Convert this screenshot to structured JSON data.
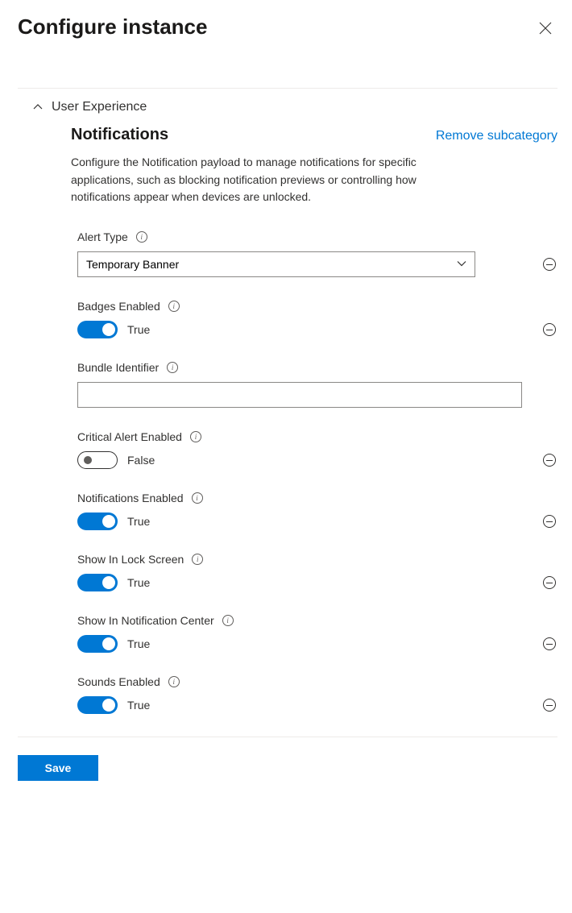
{
  "header": {
    "title": "Configure instance"
  },
  "category": {
    "label": "User Experience"
  },
  "subcategory": {
    "title": "Notifications",
    "remove_label": "Remove subcategory",
    "description": "Configure the Notification payload to manage notifications for specific applications, such as blocking notification previews or controlling how notifications appear when devices are unlocked."
  },
  "fields": {
    "alert_type": {
      "label": "Alert Type",
      "value": "Temporary Banner"
    },
    "badges_enabled": {
      "label": "Badges Enabled",
      "value": "True",
      "on": true
    },
    "bundle_identifier": {
      "label": "Bundle Identifier",
      "value": ""
    },
    "critical_alert_enabled": {
      "label": "Critical Alert Enabled",
      "value": "False",
      "on": false
    },
    "notifications_enabled": {
      "label": "Notifications Enabled",
      "value": "True",
      "on": true
    },
    "show_in_lock_screen": {
      "label": "Show In Lock Screen",
      "value": "True",
      "on": true
    },
    "show_in_notification_center": {
      "label": "Show In Notification Center",
      "value": "True",
      "on": true
    },
    "sounds_enabled": {
      "label": "Sounds Enabled",
      "value": "True",
      "on": true
    }
  },
  "footer": {
    "save_label": "Save"
  }
}
